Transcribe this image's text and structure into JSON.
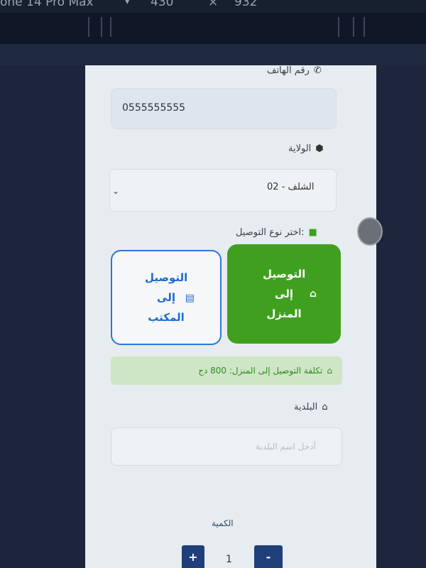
{
  "devtools": {
    "device": "one 14 Pro Max",
    "width": "430",
    "close": "×",
    "height": "932"
  },
  "form": {
    "phone": {
      "label": "رقم الهاتف",
      "value": "0555555555"
    },
    "wilaya": {
      "label": "الولاية",
      "selected": "02 - الشلف"
    },
    "delivery": {
      "label": "اختر نوع التوصيل:",
      "home": "التوصيل إلى المنزل",
      "office": "التوصيل إلى المكتب"
    },
    "cost_notice": "تكلفة التوصيل إلى المنزل: 800 دج",
    "commune": {
      "label": "البلدية",
      "placeholder": "أدخل اسم البلدية"
    },
    "quantity": {
      "label": "الكمية",
      "value": "1",
      "plus": "+",
      "minus": "-"
    }
  },
  "icons": {
    "phone": "phone-icon",
    "location": "location-pin-icon",
    "truck": "truck-icon",
    "home": "home-icon",
    "building": "building-icon",
    "chevron": "chevron-down-icon"
  }
}
